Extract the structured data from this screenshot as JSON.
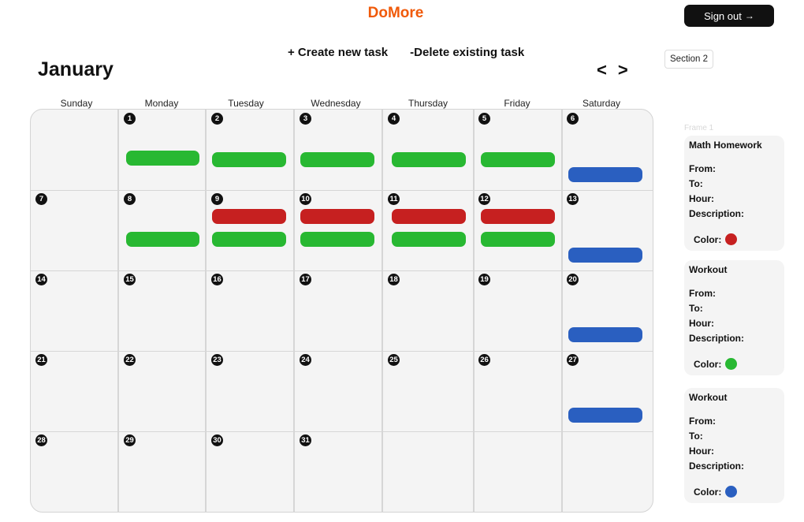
{
  "app": {
    "brand": "DoMore",
    "sign_out_label": "Sign out",
    "sign_out_arrow": "→"
  },
  "actions": {
    "create": "+ Create new task",
    "delete": "-Delete existing task"
  },
  "calendar": {
    "month": "January",
    "prev": "<",
    "next": ">",
    "weekdays": [
      "Sunday",
      "Monday",
      "Tuesday",
      "Wednesday",
      "Thursday",
      "Friday",
      "Saturday"
    ],
    "days": [
      "1",
      "2",
      "3",
      "4",
      "5",
      "6",
      "7",
      "8",
      "9",
      "10",
      "11",
      "12",
      "13",
      "14",
      "15",
      "16",
      "17",
      "18",
      "19",
      "20",
      "21",
      "22",
      "23",
      "24",
      "25",
      "26",
      "27",
      "28",
      "29",
      "30",
      "31"
    ]
  },
  "section_tag": "Section 2",
  "frame_label": "Frame 1",
  "colors": {
    "red": "#c62020",
    "green": "#28b832",
    "blue": "#2a5fc0",
    "brand": "#f05a0a"
  },
  "tasks": [
    {
      "title": "Math Homework",
      "from_label": "From:",
      "to_label": "To:",
      "hour_label": "Hour:",
      "description_label": "Description:",
      "color_label": "Color:",
      "color": "#c62020"
    },
    {
      "title": "Workout",
      "from_label": "From:",
      "to_label": "To:",
      "hour_label": "Hour:",
      "description_label": "Description:",
      "color_label": "Color:",
      "color": "#28b832"
    },
    {
      "title": "Workout",
      "from_label": "From:",
      "to_label": "To:",
      "hour_label": "Hour:",
      "description_label": "Description:",
      "color_label": "Color:",
      "color": "#2a5fc0"
    }
  ]
}
